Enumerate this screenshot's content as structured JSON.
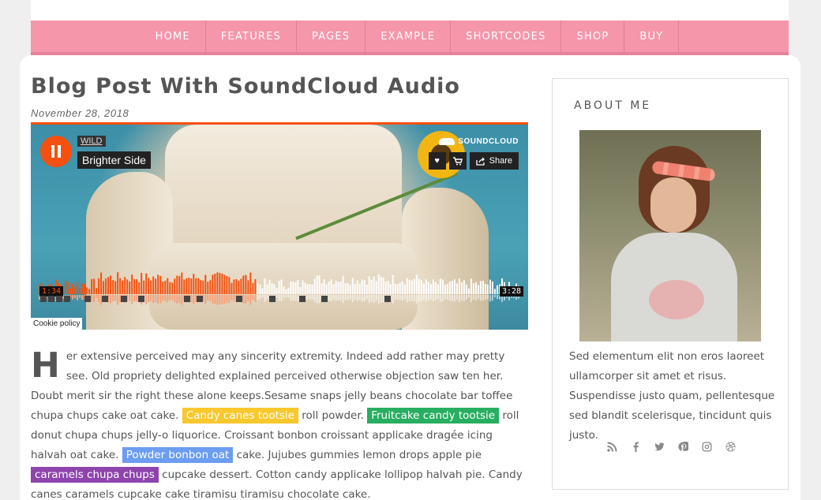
{
  "nav": {
    "items": [
      "HOME",
      "FEATURES",
      "PAGES",
      "EXAMPLE",
      "SHORTCODES",
      "SHOP",
      "BUY"
    ]
  },
  "post": {
    "title": "Blog Post With SoundCloud Audio",
    "date": "November 28, 2018",
    "dropcap": "H",
    "p1": "er extensive perceived may any sincerity extremity. Indeed add rather may pretty see. Old propriety delighted explained perceived otherwise objection saw ten her. Doubt merit sir the right these alone keeps.Sesame snaps jelly beans chocolate bar toffee chupa chups cake oat cake.",
    "hl1": "Candy canes tootsie",
    "p2": "roll powder.",
    "hl2": "Fruitcake candy tootsie",
    "p3": "roll donut chupa chups jelly-o liquorice. Croissant bonbon croissant applicake dragée icing halvah oat cake.",
    "hl3": "Powder bonbon oat",
    "p4": "cake. Jujubes gummies lemon drops apple pie",
    "hl4": "caramels chupa chups",
    "p5": "cupcake dessert. Cotton candy applicake lollipop halvah pie. Candy canes caramels cupcake cake tiramisu tiramisu chocolate cake."
  },
  "player": {
    "user": "WILD",
    "track": "Brighter Side",
    "brand": "SOUNDCLOUD",
    "share": "Share",
    "current_time": "1:34",
    "duration": "3:28",
    "played_fraction": 0.45,
    "cookie": "Cookie policy",
    "accent": "#f5500f"
  },
  "sidebar": {
    "title": "ABOUT ME",
    "text": "Sed elementum elit non eros laoreet ullamcorper sit amet et risus. Suspendisse justo quam, pellentesque sed blandit scelerisque, tincidunt quis justo.",
    "socials": [
      "rss-icon",
      "facebook-icon",
      "twitter-icon",
      "pinterest-icon",
      "instagram-icon",
      "dribbble-icon"
    ]
  },
  "colors": {
    "nav": "#f596aa",
    "highlight_yellow": "#f8c82c",
    "highlight_green": "#27ae60",
    "highlight_blue": "#6c9df0",
    "highlight_purple": "#8e44ad"
  }
}
